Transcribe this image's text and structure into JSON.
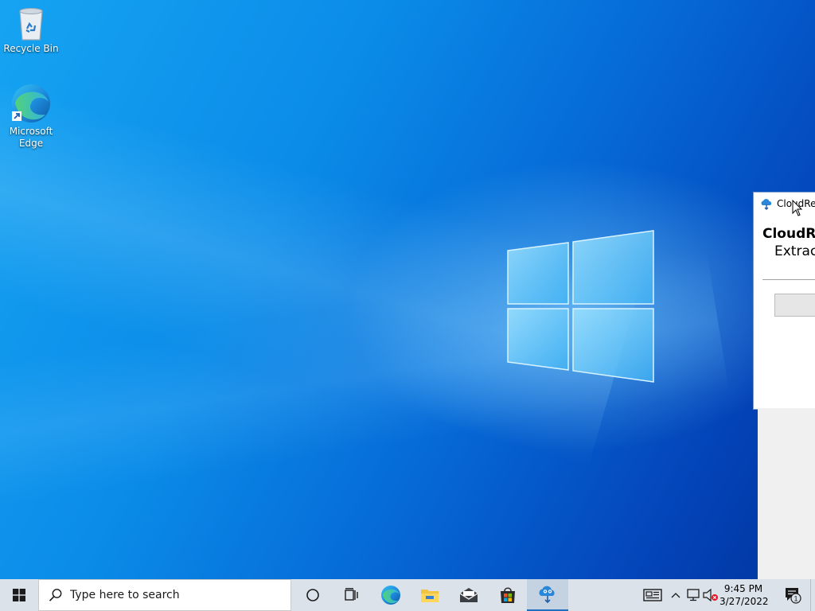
{
  "desktop": {
    "icons": [
      {
        "label": "Recycle Bin",
        "icon": "recycle-bin-icon"
      },
      {
        "label": "Microsoft\nEdge",
        "icon": "edge-icon"
      }
    ]
  },
  "dialog": {
    "title": "CloudRea",
    "heading": "CloudRe",
    "subtext": "Extract",
    "icon": "cloud-app-icon"
  },
  "taskbar": {
    "search_placeholder": "Type here to search",
    "apps": [
      "cortana-icon",
      "task-view-icon",
      "edge-icon",
      "file-explorer-icon",
      "mail-icon",
      "store-icon",
      "cloud-app-icon"
    ],
    "active_app": "cloud-app-icon",
    "tray": {
      "time": "9:45 PM",
      "date": "3/27/2022",
      "notification_count": "1",
      "icons": [
        "news-icon",
        "chevron-up-icon",
        "network-icon",
        "volume-muted-icon"
      ]
    },
    "accent": "#1f6fc2"
  },
  "colors": {
    "desktop_blue": "#0a8be8",
    "taskbar_bg": "#dbe2ea"
  }
}
